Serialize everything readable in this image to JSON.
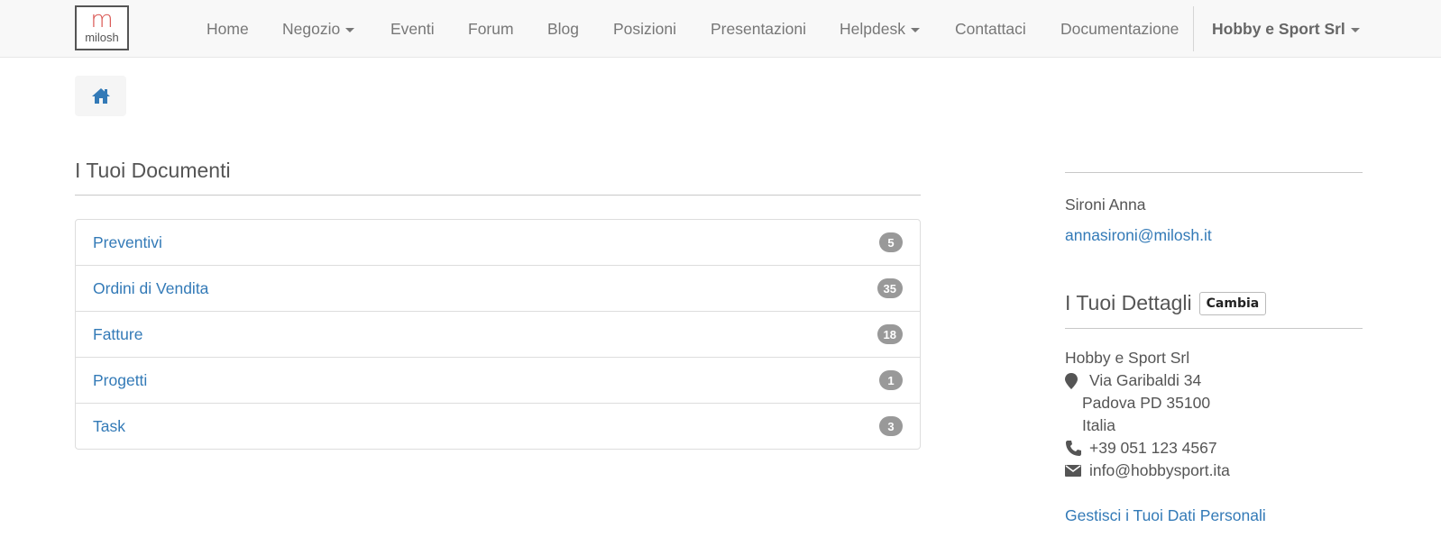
{
  "navbar": {
    "logo_text": "milosh",
    "items": [
      {
        "label": "Home"
      },
      {
        "label": "Negozio"
      },
      {
        "label": "Eventi"
      },
      {
        "label": "Forum"
      },
      {
        "label": "Blog"
      },
      {
        "label": "Posizioni"
      },
      {
        "label": "Presentazioni"
      },
      {
        "label": "Helpdesk"
      },
      {
        "label": "Contattaci"
      },
      {
        "label": "Documentazione"
      }
    ],
    "user_menu": "Hobby e Sport Srl"
  },
  "breadcrumb": {
    "icon": "home-icon"
  },
  "documents": {
    "title": "I Tuoi Documenti",
    "items": [
      {
        "label": "Preventivi",
        "count": "5"
      },
      {
        "label": "Ordini di Vendita",
        "count": "35"
      },
      {
        "label": "Fatture",
        "count": "18"
      },
      {
        "label": "Progetti",
        "count": "1"
      },
      {
        "label": "Task",
        "count": "3"
      }
    ]
  },
  "sidebar": {
    "name": "Sironi Anna",
    "email": "annasironi@milosh.it",
    "details_title": "I Tuoi Dettagli",
    "change_button": "Cambia",
    "company": "Hobby e Sport Srl",
    "street": "Via Garibaldi 34",
    "city": "Padova PD 35100",
    "country": "Italia",
    "phone": "+39 051 123 4567",
    "contact_email": "info@hobbysport.ita",
    "manage_link": "Gestisci i Tuoi Dati Personali"
  },
  "colors": {
    "link": "#337ab7",
    "badge": "#999999",
    "navbar_bg": "#f8f8f8"
  }
}
